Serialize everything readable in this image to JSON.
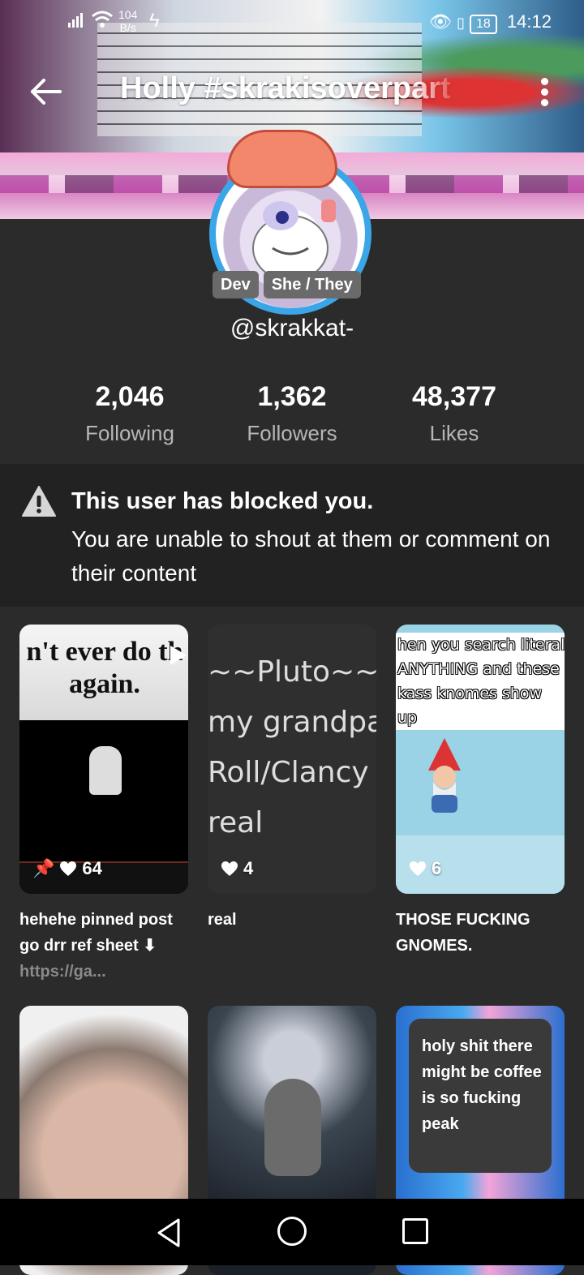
{
  "status_bar": {
    "speed_value": "104",
    "speed_unit": "B/s",
    "battery": "18",
    "time": "14:12"
  },
  "header": {
    "title": "Holly #skrakisoverpart"
  },
  "profile": {
    "badges": [
      "Dev",
      "She / They"
    ],
    "username": "@skrakkat-",
    "stats": [
      {
        "value": "2,046",
        "label": "Following"
      },
      {
        "value": "1,362",
        "label": "Followers"
      },
      {
        "value": "48,377",
        "label": "Likes"
      }
    ]
  },
  "blocked_notice": {
    "title": "This user has blocked you.",
    "message": "You are unable to shout at them or comment on their content"
  },
  "posts": [
    {
      "thumb_text": "n't ever do th again.",
      "likes": "64",
      "pinned": true,
      "caption": "hehehe pinned post go drr ref sheet ⬇",
      "link": "https://ga..."
    },
    {
      "thumb_text_lines": [
        "~~Pluto~~",
        "my grandpa",
        "Roll/Clancy",
        "real"
      ],
      "likes": "4",
      "caption": "real"
    },
    {
      "thumb_text": "hen you search literal ANYTHING and these kass knomes show up",
      "likes": "6",
      "caption": "THOSE FUCKING GNOMES."
    },
    {
      "caption": ""
    },
    {
      "caption": ""
    },
    {
      "bubble_text": "holy shit there might be coffee is so fucking peak",
      "caption": ""
    }
  ],
  "colors": {
    "background": "#2b2b2b",
    "notice_bg": "#222222",
    "badge_bg": "#6a6a6a",
    "avatar_ring": "#3aa6e8"
  }
}
